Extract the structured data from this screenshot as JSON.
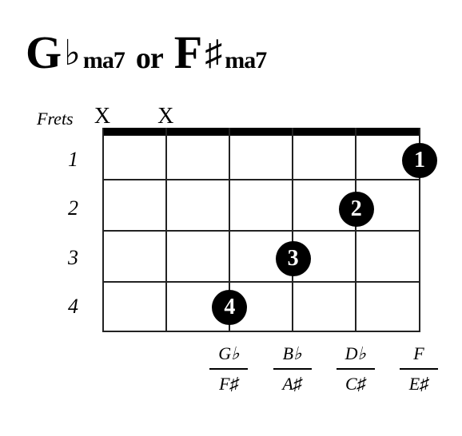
{
  "title": {
    "note1": "G",
    "acc1": "♭",
    "suffix1": "ma7",
    "or": "or",
    "note2": "F",
    "acc2": "♯",
    "suffix2": "ma7"
  },
  "frets_label": "Frets",
  "fret_numbers": [
    "1",
    "2",
    "3",
    "4"
  ],
  "mutes": [
    {
      "string": 0,
      "mark": "X"
    },
    {
      "string": 1,
      "mark": "X"
    }
  ],
  "fingers": [
    {
      "string": 5,
      "fret": 1,
      "finger": "1"
    },
    {
      "string": 4,
      "fret": 2,
      "finger": "2"
    },
    {
      "string": 3,
      "fret": 3,
      "finger": "3"
    },
    {
      "string": 2,
      "fret": 4,
      "finger": "4"
    }
  ],
  "notes": [
    {
      "string": 2,
      "flat": "G♭",
      "sharp": "F♯"
    },
    {
      "string": 3,
      "flat": "B♭",
      "sharp": "A♯"
    },
    {
      "string": 4,
      "flat": "D♭",
      "sharp": "C♯"
    },
    {
      "string": 5,
      "flat": "F",
      "sharp": "E♯"
    }
  ],
  "chart_data": {
    "type": "chord-diagram",
    "chord_names": [
      "G♭ma7",
      "F♯ma7"
    ],
    "strings": 6,
    "frets_shown": [
      1,
      2,
      3,
      4
    ],
    "muted_strings": [
      1,
      2
    ],
    "fingering": [
      {
        "string": 3,
        "fret": 4,
        "finger": 4
      },
      {
        "string": 4,
        "fret": 3,
        "finger": 3
      },
      {
        "string": 5,
        "fret": 2,
        "finger": 2
      },
      {
        "string": 6,
        "fret": 1,
        "finger": 1
      }
    ],
    "resulting_notes": {
      "flat_spelling": {
        "3": "G♭",
        "4": "B♭",
        "5": "D♭",
        "6": "F"
      },
      "sharp_spelling": {
        "3": "F♯",
        "4": "A♯",
        "5": "C♯",
        "6": "E♯"
      }
    }
  }
}
